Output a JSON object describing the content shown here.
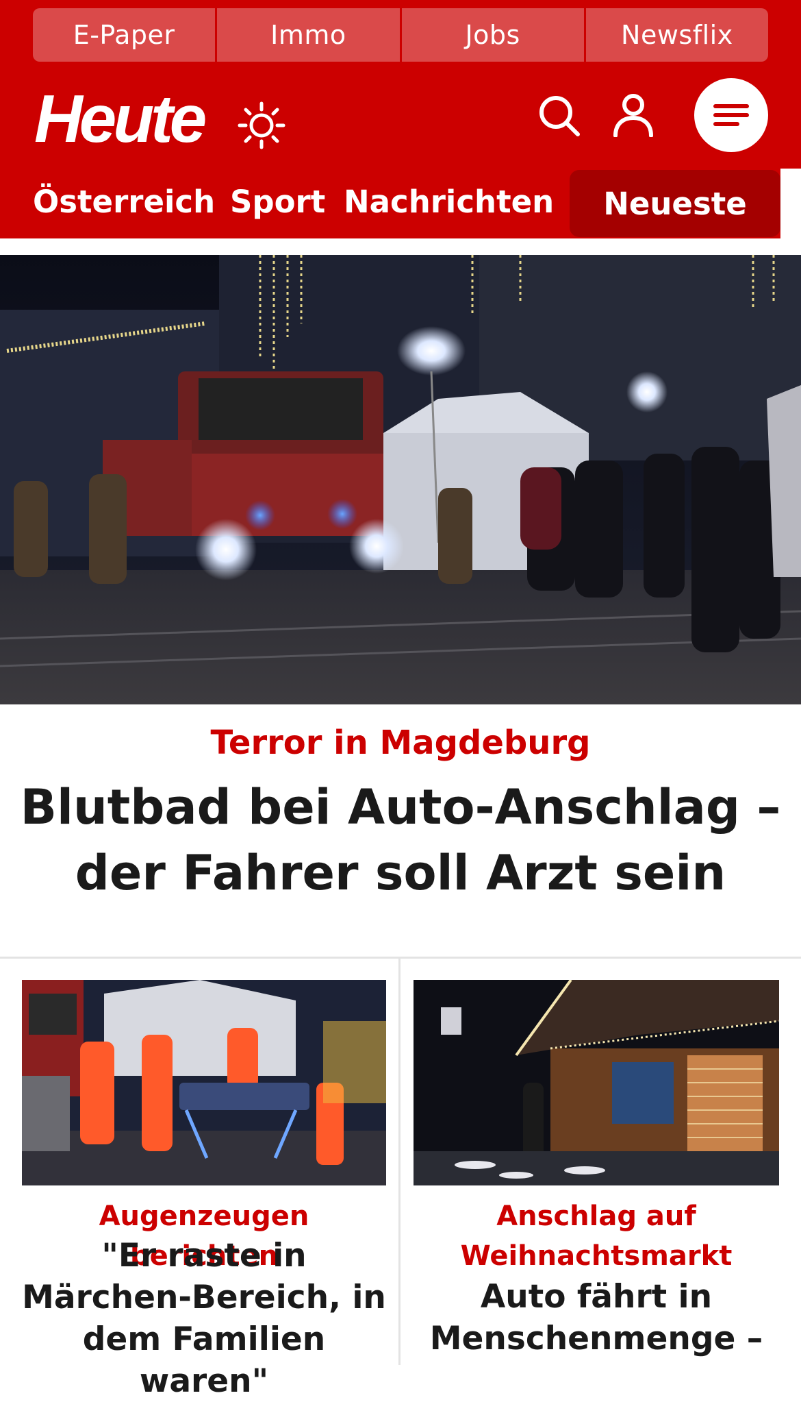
{
  "top_links": [
    "E-Paper",
    "Immo",
    "Jobs",
    "Newsflix"
  ],
  "brand": {
    "logo_text": "Heute"
  },
  "icons": {
    "weather": "sun-icon",
    "search": "search-icon",
    "account": "user-icon",
    "menu": "hamburger-menu-icon"
  },
  "nav": {
    "items": [
      "Österreich",
      "Sport",
      "Nachrichten"
    ],
    "active": "Neueste"
  },
  "hero": {
    "image_alt": "Feuerwehr und Einsatzkräfte bei Nacht am Weihnachtsmarkt",
    "kicker": "Terror in Magdeburg",
    "headline": "Blutbad bei Auto-Anschlag – der Fahrer soll Arzt sein"
  },
  "teasers": [
    {
      "image_alt": "Rettungskräfte mit Tragen",
      "kicker": "Augenzeugen berichten",
      "headline": "\"Er raste in Märchen-Bereich, in dem Familien waren\""
    },
    {
      "image_alt": "Weihnachtsmarktbuden bei Nacht",
      "kicker": "Anschlag auf Weihnachtsmarkt",
      "headline": "Auto fährt in Menschenmenge –"
    }
  ],
  "colors": {
    "brand_red": "#cc0000",
    "active_tab": "#a40000",
    "top_link_bg": "#da4a4a"
  }
}
